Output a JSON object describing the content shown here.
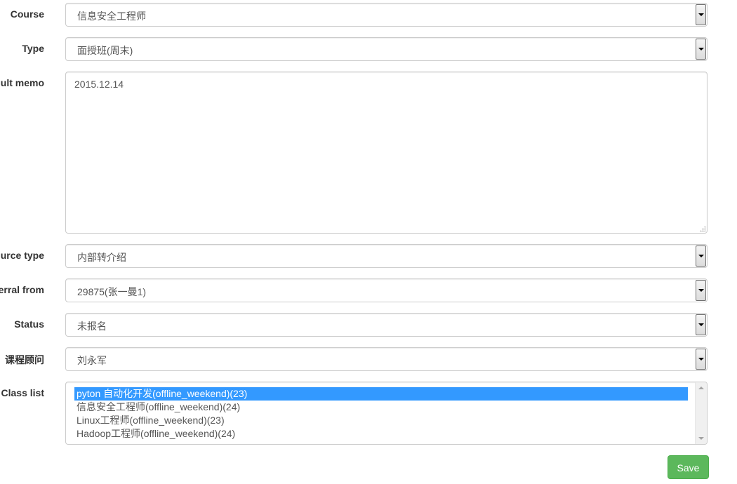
{
  "fields": {
    "course": {
      "label": "Course",
      "value": "信息安全工程师"
    },
    "type": {
      "label": "Type",
      "value": "面授班(周末)"
    },
    "consult_memo": {
      "label": "ult memo",
      "value": "2015.12.14"
    },
    "source_type": {
      "label": "urce type",
      "value": "内部转介绍"
    },
    "referral_from": {
      "label": "erral from",
      "value": "29875(张一曼1)"
    },
    "status": {
      "label": "Status",
      "value": "未报名"
    },
    "consultant": {
      "label": "课程顾问",
      "value": "刘永军"
    },
    "class_list": {
      "label": "Class list",
      "options": [
        "pyton 自动化开发(offline_weekend)(23)",
        "信息安全工程师(offline_weekend)(24)",
        "Linux工程师(offline_weekend)(23)",
        "Hadoop工程师(offline_weekend)(24)"
      ],
      "selected_index": 0
    }
  },
  "actions": {
    "save_label": "Save"
  },
  "colors": {
    "selection": "#3399ff",
    "save_button": "#5cb85c",
    "border": "#cccccc"
  }
}
